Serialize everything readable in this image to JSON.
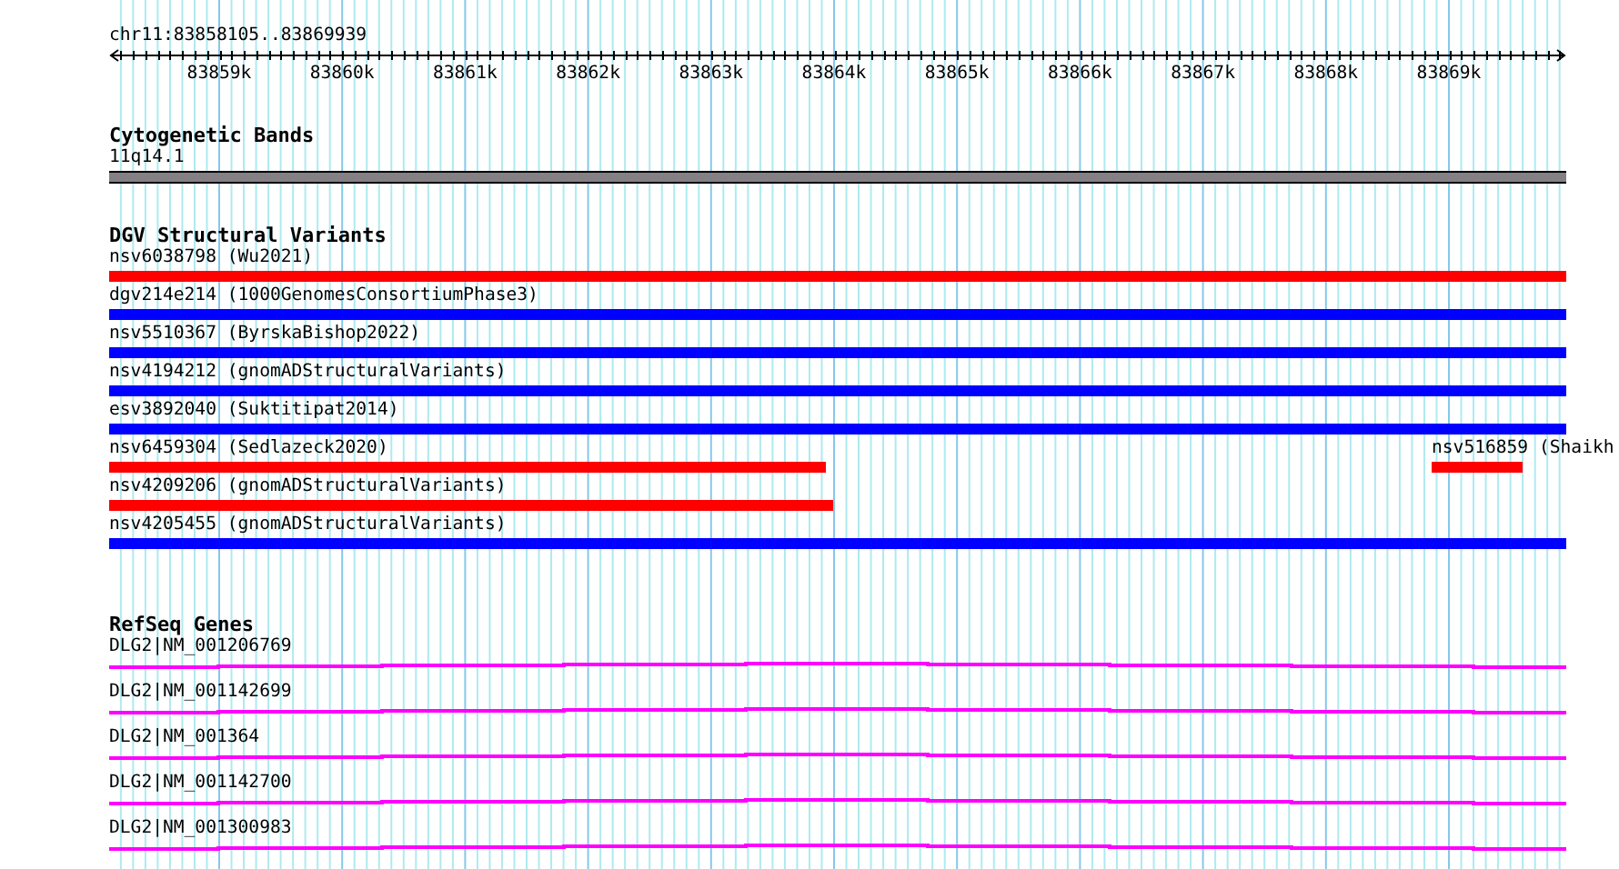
{
  "location": "chr11:83858105..83869939",
  "ruler": {
    "ticks": [
      "83859k",
      "83860k",
      "83861k",
      "83862k",
      "83863k",
      "83864k",
      "83865k",
      "83866k",
      "83867k",
      "83868k",
      "83869k"
    ]
  },
  "cytobands": {
    "title": "Cytogenetic Bands",
    "band": "11q14.1"
  },
  "dgv": {
    "title": "DGV Structural Variants",
    "rows": [
      {
        "features": [
          {
            "label": "nsv6038798 (Wu2021)",
            "color": "#ff0000"
          }
        ]
      },
      {
        "features": [
          {
            "label": "dgv214e214 (1000GenomesConsortiumPhase3)",
            "color": "#0000ff"
          }
        ]
      },
      {
        "features": [
          {
            "label": "nsv5510367 (ByrskaBishop2022)",
            "color": "#0000ff"
          }
        ]
      },
      {
        "features": [
          {
            "label": "nsv4194212 (gnomADStructuralVariants)",
            "color": "#0000ff"
          }
        ]
      },
      {
        "features": [
          {
            "label": "esv3892040 (Suktitipat2014)",
            "color": "#0000ff"
          }
        ]
      },
      {
        "features": [
          {
            "label": "nsv6459304 (Sedlazeck2020)",
            "color": "#ff0000"
          },
          {
            "label": "nsv516859 (Shaikh",
            "color": "#ff0000"
          }
        ]
      },
      {
        "features": [
          {
            "label": "nsv4209206 (gnomADStructuralVariants)",
            "color": "#ff0000"
          }
        ]
      },
      {
        "features": [
          {
            "label": "nsv4205455 (gnomADStructuralVariants)",
            "color": "#0000ff"
          }
        ]
      }
    ]
  },
  "refseq": {
    "title": "RefSeq Genes",
    "genes": [
      {
        "label": "DLG2|NM_001206769"
      },
      {
        "label": "DLG2|NM_001142699"
      },
      {
        "label": "DLG2|NM_001364"
      },
      {
        "label": "DLG2|NM_001142700"
      },
      {
        "label": "DLG2|NM_001300983"
      }
    ]
  }
}
